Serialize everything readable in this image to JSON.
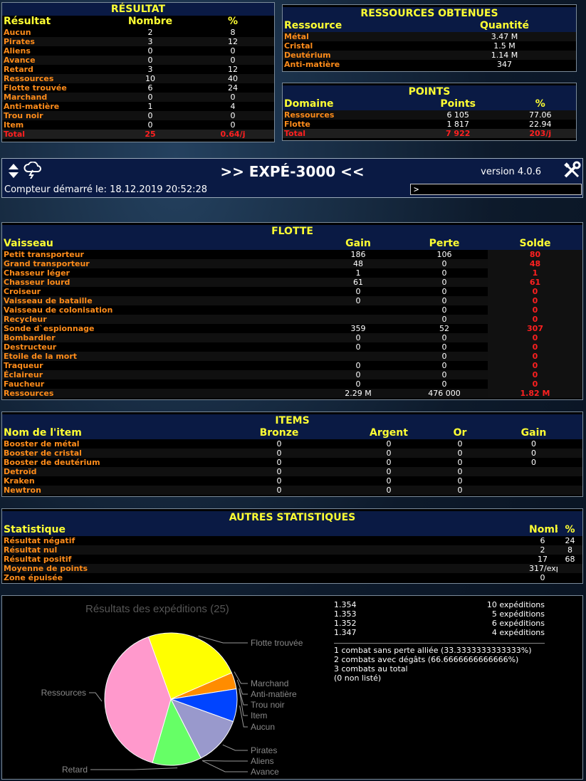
{
  "resultat": {
    "title": "RÉSULTAT",
    "headers": [
      "Résultat",
      "Nombre",
      "%"
    ],
    "rows": [
      [
        "Aucun",
        "2",
        "8"
      ],
      [
        "Pirates",
        "3",
        "12"
      ],
      [
        "Aliens",
        "0",
        "0"
      ],
      [
        "Avance",
        "0",
        "0"
      ],
      [
        "Retard",
        "3",
        "12"
      ],
      [
        "Ressources",
        "10",
        "40"
      ],
      [
        "Flotte trouvée",
        "6",
        "24"
      ],
      [
        "Marchand",
        "0",
        "0"
      ],
      [
        "Anti-matière",
        "1",
        "4"
      ],
      [
        "Trou noir",
        "0",
        "0"
      ],
      [
        "Item",
        "0",
        "0"
      ]
    ],
    "total": [
      "Total",
      "25",
      "0.64/j"
    ]
  },
  "ressources": {
    "title": "RESSOURCES OBTENUES",
    "headers": [
      "Ressource",
      "Quantité"
    ],
    "rows": [
      [
        "Métal",
        "3.47 M"
      ],
      [
        "Cristal",
        "1.5 M"
      ],
      [
        "Deutérium",
        "1.14 M"
      ],
      [
        "Anti-matière",
        "347"
      ]
    ]
  },
  "points": {
    "title": "POINTS",
    "headers": [
      "Domaine",
      "Points",
      "%"
    ],
    "rows": [
      [
        "Ressources",
        "6 105",
        "77.06"
      ],
      [
        "Flotte",
        "1 817",
        "22.94"
      ]
    ],
    "total": [
      "Total",
      "7 922",
      "203/j"
    ]
  },
  "expe": {
    "title": ">> EXPÉ-3000 <<",
    "version": "version 4.0.6",
    "compteur": "Compteur démarré le: 18.12.2019 20:52:28",
    "input_value": ">",
    "icons": [
      "sort-arrows-icon",
      "weather-storm-icon",
      "tools-icon"
    ]
  },
  "flotte": {
    "title": "FLOTTE",
    "headers": [
      "Vaisseau",
      "Gain",
      "Perte",
      "Solde"
    ],
    "rows": [
      [
        "Petit transporteur",
        "186",
        "106",
        "80"
      ],
      [
        "Grand transporteur",
        "48",
        "0",
        "48"
      ],
      [
        "Chasseur léger",
        "1",
        "0",
        "1"
      ],
      [
        "Chasseur lourd",
        "61",
        "0",
        "61"
      ],
      [
        "Croiseur",
        "0",
        "0",
        "0"
      ],
      [
        "Vaisseau de bataille",
        "0",
        "0",
        "0"
      ],
      [
        "Vaisseau de colonisation",
        "",
        "0",
        "0"
      ],
      [
        "Recycleur",
        "",
        "0",
        "0"
      ],
      [
        "Sonde d`espionnage",
        "359",
        "52",
        "307"
      ],
      [
        "Bombardier",
        "0",
        "0",
        "0"
      ],
      [
        "Destructeur",
        "0",
        "0",
        "0"
      ],
      [
        "Etoile de la mort",
        "",
        "0",
        "0"
      ],
      [
        "Traqueur",
        "0",
        "0",
        "0"
      ],
      [
        "Éclaireur",
        "0",
        "0",
        "0"
      ],
      [
        "Faucheur",
        "0",
        "0",
        "0"
      ],
      [
        "Ressources",
        "2.29 M",
        "476 000",
        "1.82 M"
      ]
    ]
  },
  "items": {
    "title": "ITEMS",
    "headers": [
      "Nom de l'item",
      "Bronze",
      "Argent",
      "Or",
      "Gain"
    ],
    "rows": [
      [
        "Booster de métal",
        "0",
        "0",
        "0",
        "0"
      ],
      [
        "Booster de cristal",
        "0",
        "0",
        "0",
        "0"
      ],
      [
        "Booster de deutérium",
        "0",
        "0",
        "0",
        "0"
      ],
      [
        "Detroïd",
        "0",
        "0",
        "0",
        ""
      ],
      [
        "Kraken",
        "0",
        "0",
        "0",
        ""
      ],
      [
        "Newtron",
        "0",
        "0",
        "0",
        ""
      ]
    ]
  },
  "autres": {
    "title": "AUTRES STATISTIQUES",
    "headers": [
      "Statistique",
      "Nombre",
      "%"
    ],
    "rows": [
      [
        "Résultat négatif",
        "6",
        "24"
      ],
      [
        "Résultat nul",
        "2",
        "8"
      ],
      [
        "Résultat positif",
        "17",
        "68"
      ],
      [
        "Moyenne de points",
        "317/expé",
        ""
      ],
      [
        "Zone épuisée",
        "0",
        ""
      ]
    ]
  },
  "chart_data": {
    "type": "pie",
    "title": "Résultats des expéditions (25)",
    "slices": [
      {
        "label": "Flotte trouvée",
        "value": 6,
        "color": "#ffff00"
      },
      {
        "label": "Marchand",
        "value": 0,
        "color": "#ff8c00"
      },
      {
        "label": "Anti-matière",
        "value": 1,
        "color": "#ff8c00"
      },
      {
        "label": "Trou noir",
        "value": 0,
        "color": "#222222"
      },
      {
        "label": "Item",
        "value": 0,
        "color": "#888888"
      },
      {
        "label": "Aucun",
        "value": 2,
        "color": "#0044ff"
      },
      {
        "label": "Pirates",
        "value": 3,
        "color": "#9999cc"
      },
      {
        "label": "Aliens",
        "value": 0,
        "color": "#00aa00"
      },
      {
        "label": "Avance",
        "value": 0,
        "color": "#aaaaaa"
      },
      {
        "label": "Retard",
        "value": 3,
        "color": "#66ff66"
      },
      {
        "label": "Ressources",
        "value": 10,
        "color": "#ff99cc"
      }
    ]
  },
  "stats_right": {
    "rows": [
      [
        "1.354",
        "10 expéditions"
      ],
      [
        "1.353",
        "5 expéditions"
      ],
      [
        "1.352",
        "6 expéditions"
      ],
      [
        "1.347",
        "4 expéditions"
      ]
    ],
    "lines": [
      "1 combat sans perte alliée (33.3333333333333%)",
      "2 combats avec dégâts (66.6666666666666%)",
      "3 combats au total",
      "(0 non listé)"
    ]
  }
}
